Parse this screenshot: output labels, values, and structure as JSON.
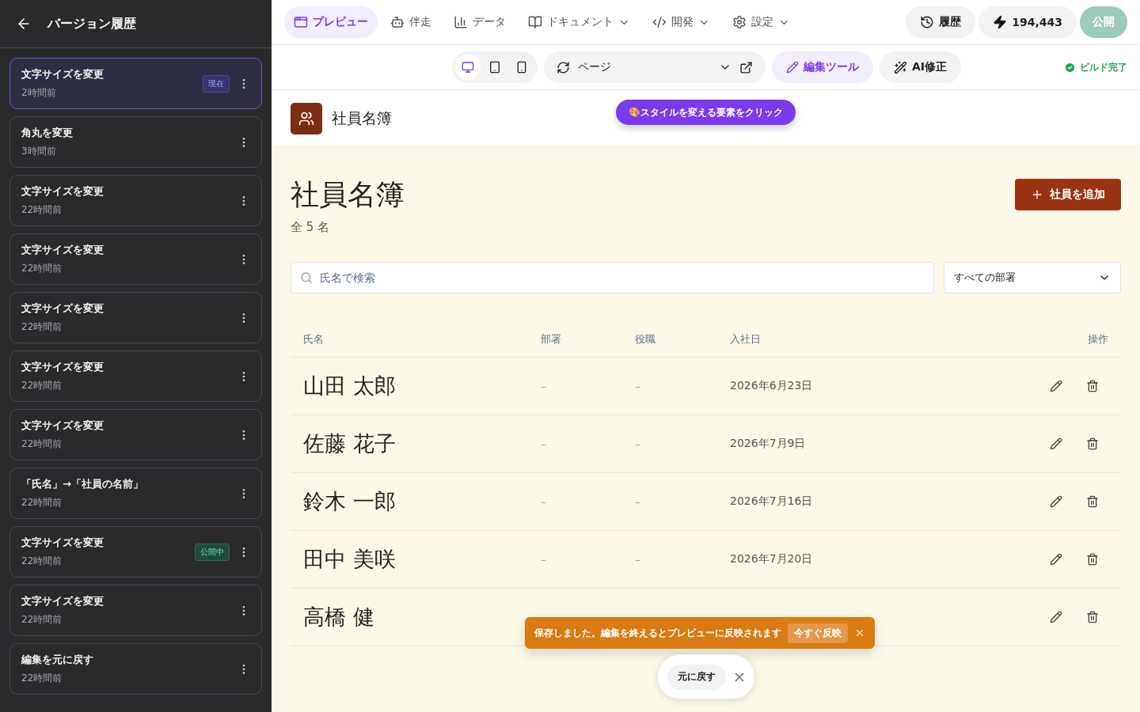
{
  "sidebar": {
    "title": "バージョン履歴",
    "versions": [
      {
        "title": "文字サイズを変更",
        "time": "2時間前",
        "selected": true,
        "badge": {
          "text": "現在",
          "kind": "current"
        }
      },
      {
        "title": "角丸を変更",
        "time": "3時間前",
        "selected": false
      },
      {
        "title": "文字サイズを変更",
        "time": "22時間前",
        "selected": false
      },
      {
        "title": "文字サイズを変更",
        "time": "22時間前",
        "selected": false
      },
      {
        "title": "文字サイズを変更",
        "time": "22時間前",
        "selected": false
      },
      {
        "title": "文字サイズを変更",
        "time": "22時間前",
        "selected": false
      },
      {
        "title": "文字サイズを変更",
        "time": "22時間前",
        "selected": false
      },
      {
        "title": "「氏名」→「社員の名前」",
        "time": "22時間前",
        "selected": false
      },
      {
        "title": "文字サイズを変更",
        "time": "22時間前",
        "selected": false,
        "badge": {
          "text": "公開中",
          "kind": "published"
        }
      },
      {
        "title": "文字サイズを変更",
        "time": "22時間前",
        "selected": false
      },
      {
        "title": "編集を元に戻す",
        "time": "22時間前",
        "selected": false
      }
    ]
  },
  "nav_tabs": [
    {
      "label": "プレビュー",
      "selected": true,
      "has_menu": false
    },
    {
      "label": "伴走",
      "selected": false,
      "has_menu": false
    },
    {
      "label": "データ",
      "selected": false,
      "has_menu": false
    },
    {
      "label": "ドキュメント",
      "selected": false,
      "has_menu": true
    },
    {
      "label": "開発",
      "selected": false,
      "has_menu": true
    },
    {
      "label": "設定",
      "selected": false,
      "has_menu": true
    }
  ],
  "top_actions": {
    "history": "履歴",
    "credits": "194,443",
    "publish": "公開"
  },
  "toolbar": {
    "devices": [
      {
        "kind": "desktop",
        "selected": true
      },
      {
        "kind": "tablet",
        "selected": false
      },
      {
        "kind": "mobile",
        "selected": false
      }
    ],
    "page_select": "ページ",
    "edit_tool": "編集ツール",
    "ai_fix": "AI修正",
    "build_status": "ビルド完了"
  },
  "app": {
    "brand": "社員名簿",
    "hint": "🎨スタイルを変える要素をクリック",
    "heading": "社員名簿",
    "count": "全 5 名",
    "add_button": "社員を追加",
    "search": {
      "placeholder": "氏名で検索"
    },
    "department_filter": "すべての部署",
    "table": {
      "columns": [
        "氏名",
        "部署",
        "役職",
        "入社日",
        "操作"
      ],
      "rows": [
        {
          "name": "山田 太郎",
          "department": "–",
          "role": "–",
          "joined": "2026年6月23日"
        },
        {
          "name": "佐藤 花子",
          "department": "–",
          "role": "–",
          "joined": "2026年7月9日"
        },
        {
          "name": "鈴木 一郎",
          "department": "–",
          "role": "–",
          "joined": "2026年7月16日"
        },
        {
          "name": "田中 美咲",
          "department": "–",
          "role": "–",
          "joined": "2026年7月20日"
        },
        {
          "name": "高橋 健"
        }
      ]
    }
  },
  "toast": {
    "message": "保存しました。編集を終えるとプレビューに反映されます",
    "action": "今すぐ反映"
  },
  "undo": {
    "label": "元に戻す"
  }
}
